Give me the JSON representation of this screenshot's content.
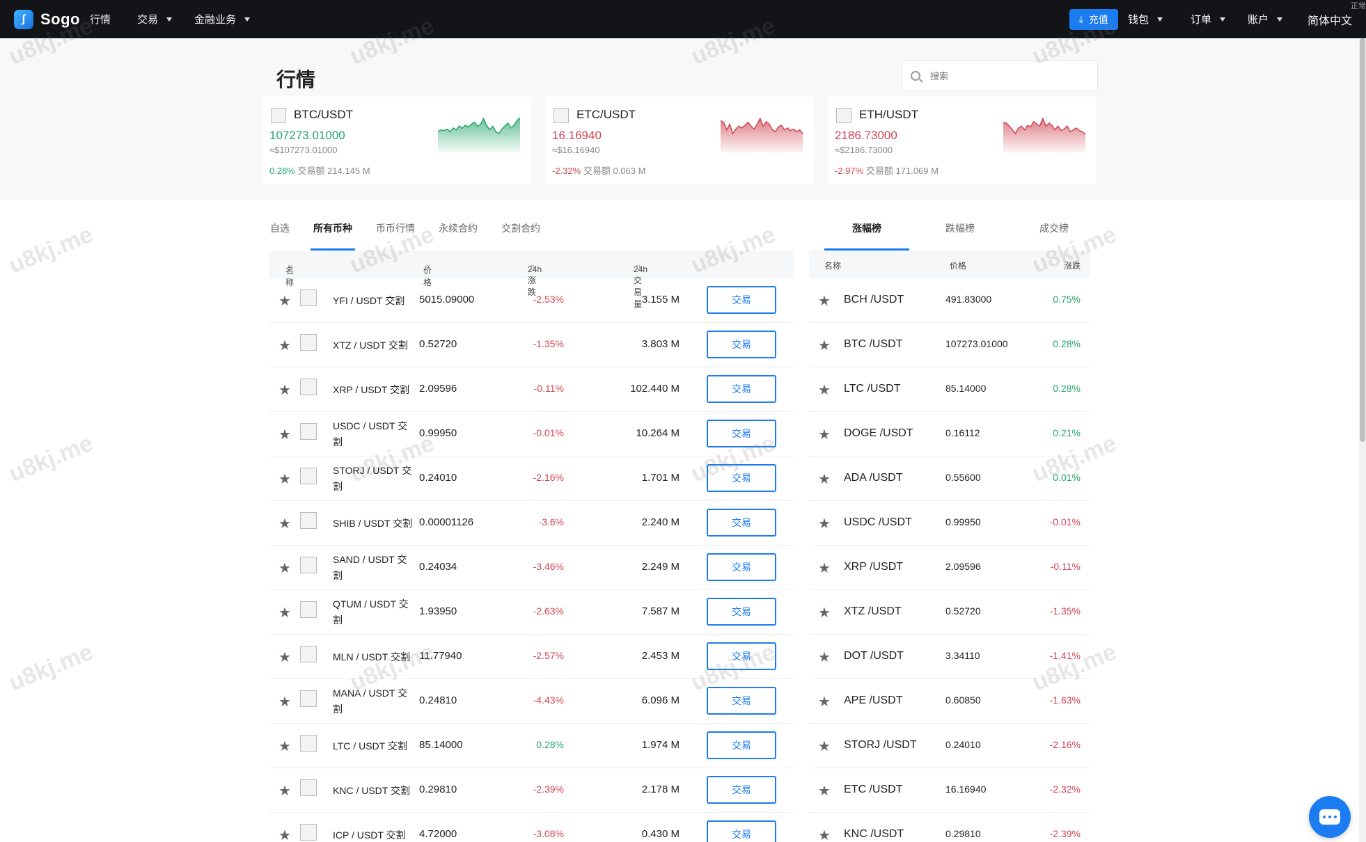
{
  "nav": {
    "brand": "Sogo",
    "items": [
      {
        "label": "行情",
        "caret": false
      },
      {
        "label": "交易",
        "caret": true
      },
      {
        "label": "金融业务",
        "caret": true
      }
    ],
    "deposit_label": "充值",
    "right_items": [
      {
        "label": "钱包"
      },
      {
        "label": "订单"
      },
      {
        "label": "账户"
      }
    ],
    "language": "简体中文",
    "corner_text": "正常"
  },
  "page": {
    "title": "行情",
    "search_placeholder": "搜索"
  },
  "tickers": [
    {
      "pair": "BTC/USDT",
      "price": "107273.01000",
      "usd": "≈$107273.01000",
      "change": "0.28%",
      "volume_label": "交易额",
      "volume": "214.145 M",
      "trend": "up",
      "color": "#25a56a"
    },
    {
      "pair": "ETC/USDT",
      "price": "16.16940",
      "usd": "≈$16.16940",
      "change": "-2.32%",
      "volume_label": "交易额",
      "volume": "0.063 M",
      "trend": "down",
      "color": "#d04555"
    },
    {
      "pair": "ETH/USDT",
      "price": "2186.73000",
      "usd": "≈$2186.73000",
      "change": "-2.97%",
      "volume_label": "交易额",
      "volume": "171.069 M",
      "trend": "down",
      "color": "#d04555"
    }
  ],
  "sparklines": [
    [
      0.55,
      0.6,
      0.58,
      0.62,
      0.55,
      0.65,
      0.6,
      0.7,
      0.64,
      0.72,
      0.68,
      0.75,
      0.8,
      0.7,
      0.74,
      0.9,
      0.72,
      0.6,
      0.7,
      0.55,
      0.5,
      0.62,
      0.7,
      0.78,
      0.65,
      0.72,
      0.85,
      0.92
    ],
    [
      0.85,
      0.8,
      0.6,
      0.75,
      0.5,
      0.62,
      0.7,
      0.65,
      0.72,
      0.8,
      0.7,
      0.62,
      0.75,
      0.9,
      0.7,
      0.82,
      0.75,
      0.6,
      0.55,
      0.68,
      0.72,
      0.6,
      0.65,
      0.58,
      0.62,
      0.55,
      0.6,
      0.5
    ],
    [
      0.8,
      0.78,
      0.7,
      0.6,
      0.5,
      0.65,
      0.7,
      0.6,
      0.72,
      0.68,
      0.82,
      0.75,
      0.7,
      0.9,
      0.7,
      0.78,
      0.72,
      0.6,
      0.7,
      0.58,
      0.62,
      0.7,
      0.55,
      0.6,
      0.65,
      0.58,
      0.55,
      0.48
    ]
  ],
  "tabs": [
    "自选",
    "所有币种",
    "币币行情",
    "永续合约",
    "交割合约"
  ],
  "active_tab": "所有币种",
  "market_table": {
    "columns": {
      "name": "名称",
      "price": "价格",
      "change": "24h涨跌",
      "volume": "24h交易量"
    },
    "trade_label": "交易",
    "rows": [
      {
        "name": "YFI / USDT 交割",
        "price": "5015.09000",
        "change": "-2.53%",
        "volume": "3.155 M",
        "dir": "down"
      },
      {
        "name": "XTZ / USDT 交割",
        "price": "0.52720",
        "change": "-1.35%",
        "volume": "3.803 M",
        "dir": "down"
      },
      {
        "name": "XRP / USDT 交割",
        "price": "2.09596",
        "change": "-0.11%",
        "volume": "102.440 M",
        "dir": "down"
      },
      {
        "name": "USDC / USDT 交割",
        "price": "0.99950",
        "change": "-0.01%",
        "volume": "10.264 M",
        "dir": "down"
      },
      {
        "name": "STORJ / USDT 交割",
        "price": "0.24010",
        "change": "-2.16%",
        "volume": "1.701 M",
        "dir": "down"
      },
      {
        "name": "SHIB / USDT 交割",
        "price": "0.00001126",
        "change": "-3.6%",
        "volume": "2.240 M",
        "dir": "down"
      },
      {
        "name": "SAND / USDT 交割",
        "price": "0.24034",
        "change": "-3.46%",
        "volume": "2.249 M",
        "dir": "down"
      },
      {
        "name": "QTUM / USDT 交割",
        "price": "1.93950",
        "change": "-2.63%",
        "volume": "7.587 M",
        "dir": "down"
      },
      {
        "name": "MLN / USDT 交割",
        "price": "11.77940",
        "change": "-2.57%",
        "volume": "2.453 M",
        "dir": "down"
      },
      {
        "name": "MANA / USDT 交割",
        "price": "0.24810",
        "change": "-4.43%",
        "volume": "6.096 M",
        "dir": "down"
      },
      {
        "name": "LTC / USDT 交割",
        "price": "85.14000",
        "change": "0.28%",
        "volume": "1.974 M",
        "dir": "up"
      },
      {
        "name": "KNC / USDT 交割",
        "price": "0.29810",
        "change": "-2.39%",
        "volume": "2.178 M",
        "dir": "down"
      },
      {
        "name": "ICP / USDT 交割",
        "price": "4.72000",
        "change": "-3.08%",
        "volume": "0.430 M",
        "dir": "down"
      }
    ]
  },
  "ranking": {
    "tabs": [
      "涨幅榜",
      "跌幅榜",
      "成交榜"
    ],
    "active_tab": "涨幅榜",
    "columns": {
      "name": "名称",
      "price": "价格",
      "change": "涨跌"
    },
    "rows": [
      {
        "pair": "BCH /USDT",
        "price": "491.83000",
        "change": "0.75%",
        "dir": "up"
      },
      {
        "pair": "BTC /USDT",
        "price": "107273.01000",
        "change": "0.28%",
        "dir": "up"
      },
      {
        "pair": "LTC /USDT",
        "price": "85.14000",
        "change": "0.28%",
        "dir": "up"
      },
      {
        "pair": "DOGE /USDT",
        "price": "0.16112",
        "change": "0.21%",
        "dir": "up"
      },
      {
        "pair": "ADA /USDT",
        "price": "0.55600",
        "change": "0.01%",
        "dir": "up"
      },
      {
        "pair": "USDC /USDT",
        "price": "0.99950",
        "change": "-0.01%",
        "dir": "down"
      },
      {
        "pair": "XRP /USDT",
        "price": "2.09596",
        "change": "-0.11%",
        "dir": "down"
      },
      {
        "pair": "XTZ /USDT",
        "price": "0.52720",
        "change": "-1.35%",
        "dir": "down"
      },
      {
        "pair": "DOT /USDT",
        "price": "3.34110",
        "change": "-1.41%",
        "dir": "down"
      },
      {
        "pair": "APE /USDT",
        "price": "0.60850",
        "change": "-1.63%",
        "dir": "down"
      },
      {
        "pair": "STORJ /USDT",
        "price": "0.24010",
        "change": "-2.16%",
        "dir": "down"
      },
      {
        "pair": "ETC /USDT",
        "price": "16.16940",
        "change": "-2.32%",
        "dir": "down"
      },
      {
        "pair": "KNC /USDT",
        "price": "0.29810",
        "change": "-2.39%",
        "dir": "down"
      }
    ]
  },
  "watermark": "u8kj.me",
  "icons": {
    "logo": "logo-icon",
    "download": "download-icon",
    "search": "search-icon",
    "star": "star-icon",
    "chat": "chat-icon"
  }
}
